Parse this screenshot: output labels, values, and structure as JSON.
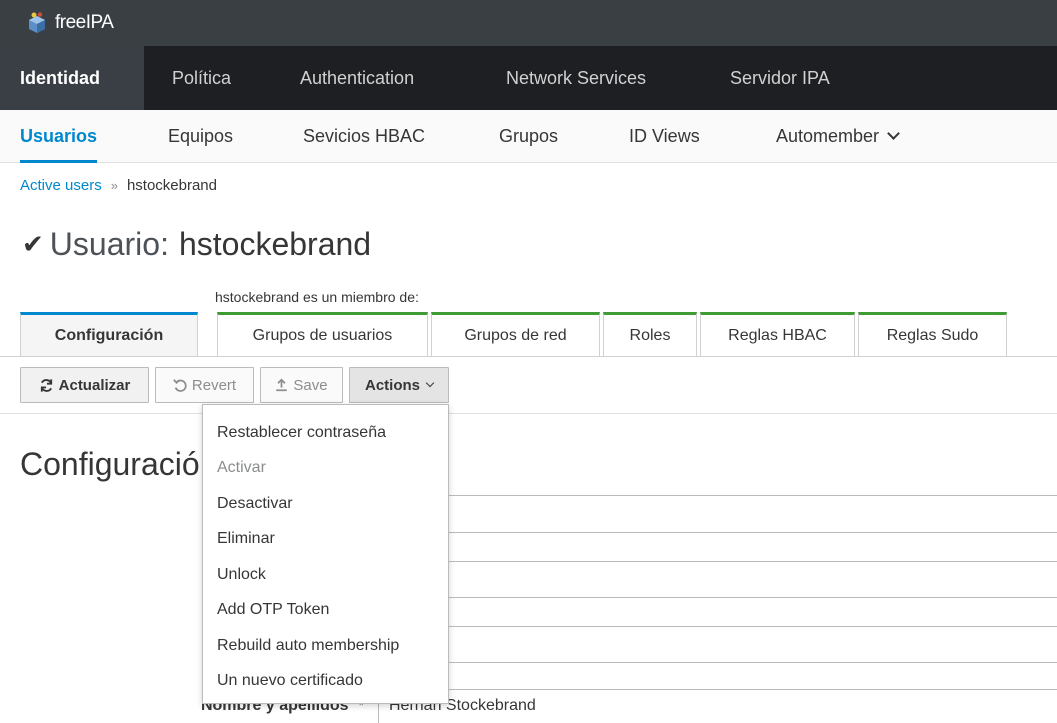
{
  "brand": {
    "name": "freeIPA",
    "icon": "freeipa-logo-icon"
  },
  "primary_nav": [
    {
      "label": "Identidad",
      "active": true
    },
    {
      "label": "Política"
    },
    {
      "label": "Authentication"
    },
    {
      "label": "Network Services"
    },
    {
      "label": "Servidor IPA"
    }
  ],
  "secondary_nav": [
    {
      "label": "Usuarios",
      "active": true
    },
    {
      "label": "Equipos"
    },
    {
      "label": "Sevicios HBAC"
    },
    {
      "label": "Grupos"
    },
    {
      "label": "ID Views"
    },
    {
      "label": "Automember"
    }
  ],
  "breadcrumb": {
    "parent": "Active users",
    "separator": "»",
    "current": "hstockebrand"
  },
  "page_title": {
    "check_icon": "checkmark-icon",
    "label": "Usuario:",
    "name": "hstockebrand"
  },
  "member_of_label": "hstockebrand es un miembro de:",
  "tabs": [
    {
      "label": "Configuración",
      "active": true
    },
    {
      "label": "Grupos de usuarios"
    },
    {
      "label": "Grupos de red"
    },
    {
      "label": "Roles"
    },
    {
      "label": "Reglas HBAC"
    },
    {
      "label": "Reglas Sudo"
    }
  ],
  "toolbar": {
    "refresh": "Actualizar",
    "revert": "Revert",
    "save": "Save",
    "actions": "Actions"
  },
  "section_title": "Configuració",
  "actions_menu": [
    {
      "label": "Restablecer contraseña"
    },
    {
      "label": "Activar",
      "disabled": true
    },
    {
      "label": "Desactivar"
    },
    {
      "label": "Eliminar"
    },
    {
      "label": "Unlock"
    },
    {
      "label": "Add OTP Token"
    },
    {
      "label": "Rebuild auto membership"
    },
    {
      "label": "Un nuevo certificado"
    }
  ],
  "form": {
    "partial_value": "brand",
    "full_name_label": "Nombre y apellidos",
    "full_name_required": "*",
    "full_name_value": "Hernan Stockebrand"
  },
  "colors": {
    "accent": "#0088ce",
    "tab_green": "#3f9c35",
    "nav_bg": "#1d1f22",
    "brand_bg": "#3a3f44"
  }
}
